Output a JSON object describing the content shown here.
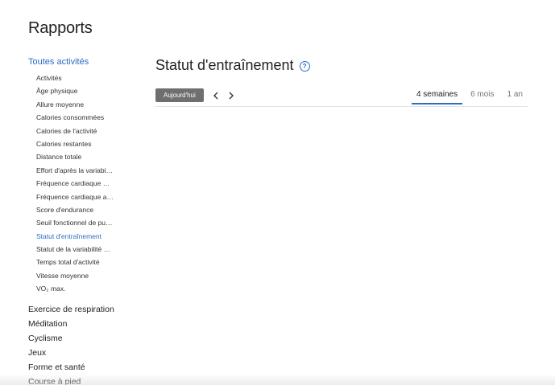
{
  "page": {
    "title": "Rapports"
  },
  "sidebar": {
    "active_category": "Toutes activités",
    "sub_items": [
      "Activités",
      "Âge physique",
      "Allure moyenne",
      "Calories consommées",
      "Calories de l'activité",
      "Calories restantes",
      "Distance totale",
      "Effort d'après la variabilité de la fréquence cardiaque",
      "Fréquence cardiaque maximale",
      "Fréquence cardiaque au repos",
      "Score d'endurance",
      "Seuil fonctionnel de puissance",
      "Statut d'entraînement",
      "Statut de la variabilité de la fréquence cardiaque",
      "Temps total d'activité",
      "Vitesse moyenne",
      "VO₂ max."
    ],
    "active_sub_item_index": 12,
    "categories": [
      "Exercice de respiration",
      "Méditation",
      "Cyclisme",
      "Jeux",
      "Forme et santé",
      "Course à pied"
    ]
  },
  "main": {
    "title": "Statut d'entraînement",
    "help_icon": "question-circle-icon",
    "today_label": "Aujourd'hui",
    "prev_icon": "chevron-left-icon",
    "next_icon": "chevron-right-icon",
    "range_tabs": [
      "4 semaines",
      "6 mois",
      "1 an"
    ],
    "active_range_index": 0
  },
  "colors": {
    "accent": "#2b6cc4",
    "today_button_bg": "#6f6f6f"
  }
}
